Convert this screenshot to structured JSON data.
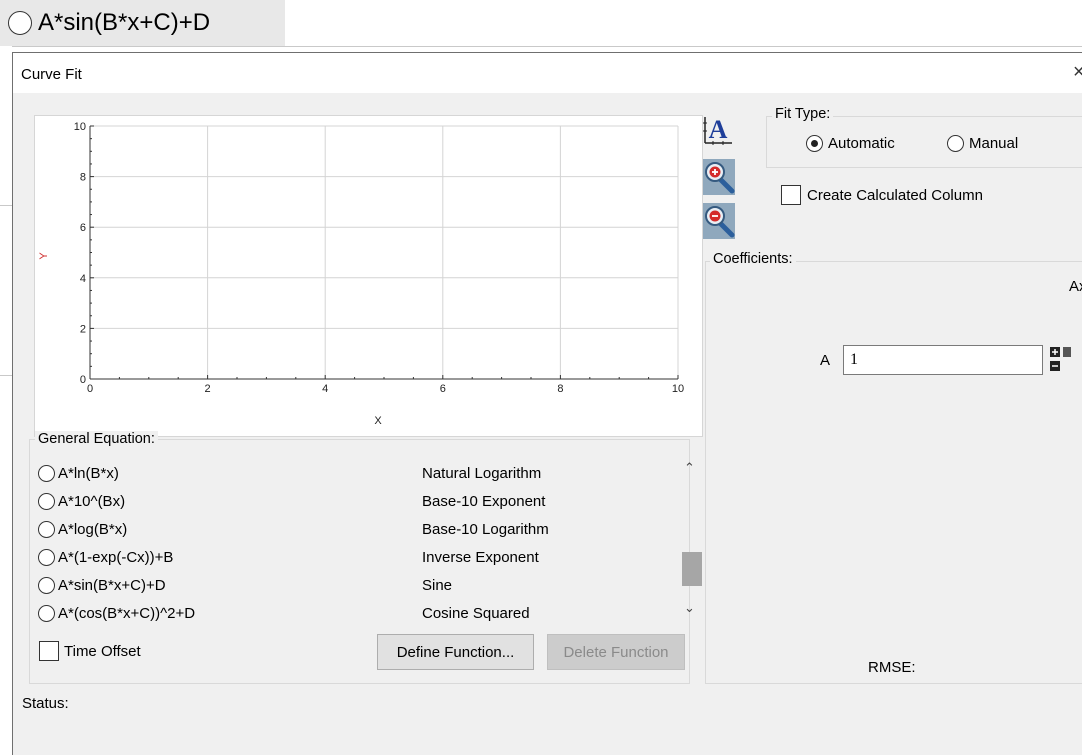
{
  "banner": {
    "equation": "A*sin(B*x+C)+D"
  },
  "dialog": {
    "title": "Curve Fit",
    "close_glyph": "×"
  },
  "plot": {
    "xlabel": "X",
    "ylabel": "Y",
    "x_ticks": [
      "0",
      "2",
      "4",
      "6",
      "8",
      "10"
    ],
    "y_ticks": [
      "0",
      "2",
      "4",
      "6",
      "8",
      "10"
    ]
  },
  "chart_data": {
    "type": "line",
    "title": "",
    "xlabel": "X",
    "ylabel": "Y",
    "xlim": [
      0,
      10
    ],
    "ylim": [
      0,
      10
    ],
    "grid": true,
    "series": []
  },
  "tools": {
    "autoscale_icon": "autoscale-A-icon",
    "zoom_in_icon": "zoom-in-icon",
    "zoom_out_icon": "zoom-out-icon"
  },
  "fit_type": {
    "label": "Fit Type:",
    "options": [
      {
        "label": "Automatic",
        "checked": true
      },
      {
        "label": "Manual",
        "checked": false
      }
    ]
  },
  "calc_column": {
    "label": "Create Calculated Column",
    "checked": false
  },
  "coefficients": {
    "label": "Coefficients:",
    "column_header": "Ax",
    "rows": [
      {
        "name": "A",
        "value": "1"
      }
    ],
    "rmse_label": "RMSE:"
  },
  "general_equation": {
    "label": "General Equation:",
    "items": [
      {
        "equation": "A*ln(B*x)",
        "name": "Natural Logarithm"
      },
      {
        "equation": "A*10^(Bx)",
        "name": "Base-10 Exponent"
      },
      {
        "equation": "A*log(B*x)",
        "name": "Base-10 Logarithm"
      },
      {
        "equation": "A*(1-exp(-Cx))+B",
        "name": "Inverse Exponent"
      },
      {
        "equation": "A*sin(B*x+C)+D",
        "name": "Sine"
      },
      {
        "equation": "A*(cos(B*x+C))^2+D",
        "name": "Cosine Squared"
      }
    ]
  },
  "time_offset": {
    "label": "Time Offset",
    "checked": false
  },
  "buttons": {
    "define": "Define Function...",
    "delete": "Delete Function"
  },
  "status": {
    "label": "Status:"
  }
}
